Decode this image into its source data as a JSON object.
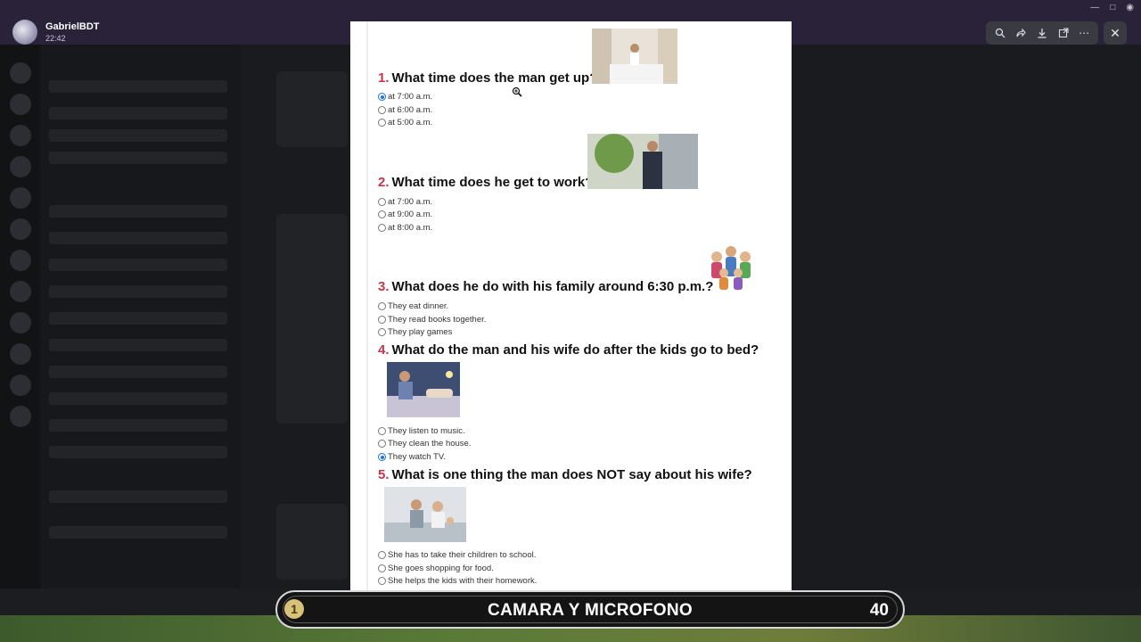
{
  "viewer": {
    "user_name": "GabrielBDT",
    "time": "22:42"
  },
  "quiz": {
    "questions": [
      {
        "number": "1.",
        "text": "What time does the man get up?",
        "options": [
          "at 7:00 a.m.",
          "at 6:00 a.m.",
          "at 5:00 a.m."
        ],
        "selected_index": 0
      },
      {
        "number": "2.",
        "text": "What time does he get to work?",
        "options": [
          "at 7:00 a.m.",
          "at 9:00 a.m.",
          "at 8:00 a.m."
        ],
        "selected_index": null
      },
      {
        "number": "3.",
        "text": "What does he do with his family around 6:30 p.m.?",
        "options": [
          "They eat dinner.",
          "They read books together.",
          "They play games"
        ],
        "selected_index": null
      },
      {
        "number": "4.",
        "text": "What do the man and his wife do after the kids go to bed?",
        "options": [
          "They listen to music.",
          "They clean the house.",
          "They watch TV."
        ],
        "selected_index": 2
      },
      {
        "number": "5.",
        "text": "What is one thing the man does NOT say about his wife?",
        "options": [
          "She has to take their children to school.",
          "She goes shopping for food.",
          "She helps the kids with their homework."
        ],
        "selected_index": null
      }
    ]
  },
  "banner": {
    "text": "CAMARA Y MICROFONO",
    "left_number": "1",
    "right_number": "40"
  },
  "colors": {
    "question_number": "#c2384a",
    "radio_selected": "#1a73e8",
    "viewer_bar": "#2a2238"
  },
  "icons": {
    "toolbar": [
      "zoom-icon",
      "forward-icon",
      "download-icon",
      "open-external-icon",
      "more-icon"
    ],
    "close": "close-icon"
  }
}
